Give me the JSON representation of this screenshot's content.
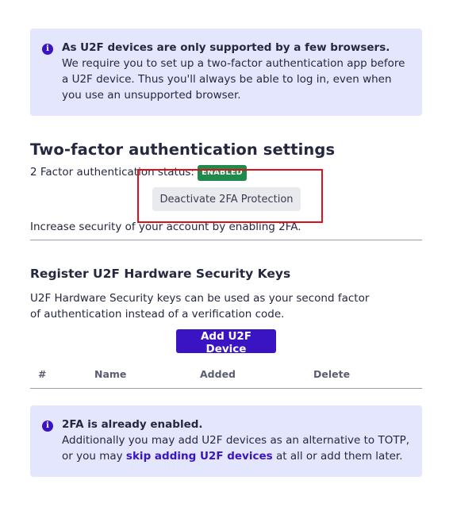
{
  "notice_top": {
    "title": "As U2F devices are only supported by a few browsers.",
    "body": "We require you to set up a two-factor authentication app before a U2F device. Thus you'll always be able to log in, even when you use an unsupported browser."
  },
  "twofa": {
    "heading": "Two-factor authentication settings",
    "status_label": "2 Factor authentication status:",
    "status_badge": "ENABLED",
    "status_color": "#1f8a4c",
    "deactivate_label": "Deactivate 2FA Protection",
    "increase_text": "Increase security of your account by enabling 2FA."
  },
  "u2f": {
    "heading": "Register U2F Hardware Security Keys",
    "description": "U2F Hardware Security keys can be used as your second factor of authentication instead of a verification code.",
    "add_label": "Add U2F Device",
    "columns": [
      "#",
      "Name",
      "Added",
      "Delete"
    ]
  },
  "notice_bottom": {
    "title": "2FA is already enabled.",
    "body_prefix": "Additionally you may add U2F devices as an alternative to TOTP, or you may",
    "link_text": "skip adding U2F devices",
    "body_suffix": "at all or add them later."
  },
  "colors": {
    "accent": "#3a14c2",
    "alert_bg": "#e3e6fd",
    "highlight_box": "#e0101a"
  }
}
